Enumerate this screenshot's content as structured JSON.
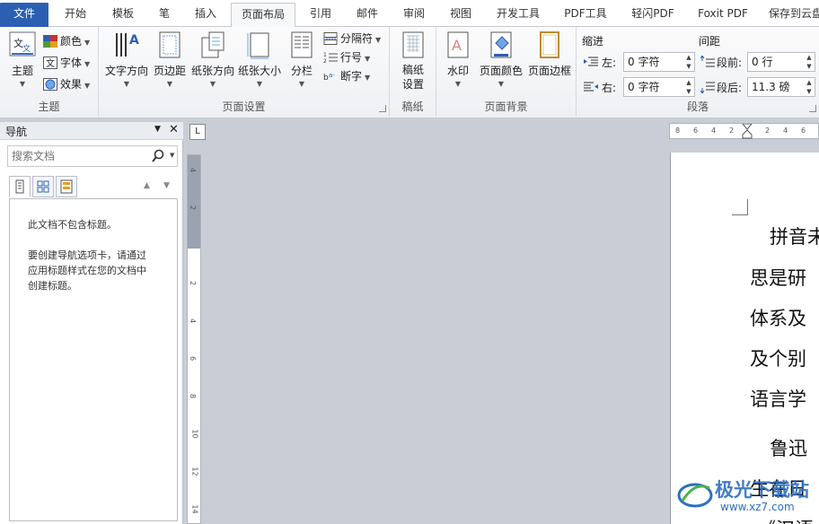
{
  "tabs": [
    {
      "label": "文件",
      "kind": "file"
    },
    {
      "label": "开始"
    },
    {
      "label": "模板"
    },
    {
      "label": "笔"
    },
    {
      "label": "插入"
    },
    {
      "label": "页面布局",
      "kind": "active"
    },
    {
      "label": "引用"
    },
    {
      "label": "邮件"
    },
    {
      "label": "审阅"
    },
    {
      "label": "视图"
    },
    {
      "label": "开发工具"
    },
    {
      "label": "PDF工具"
    },
    {
      "label": "轻闪PDF"
    },
    {
      "label": "Foxit PDF"
    },
    {
      "label": "保存到云盘"
    }
  ],
  "ribbon": {
    "theme": {
      "group_label": "主题",
      "themes_label": "主题",
      "colors_label": "颜色",
      "fonts_label": "字体",
      "effects_label": "效果"
    },
    "page_setup": {
      "group_label": "页面设置",
      "text_direction": "文字方向",
      "margins": "页边距",
      "orientation": "纸张方向",
      "size": "纸张大小",
      "columns": "分栏",
      "breaks": "分隔符",
      "line_numbers": "行号",
      "hyphenation": "断字"
    },
    "paper": {
      "group_label": "稿纸",
      "paper_setup": "稿纸\n设置"
    },
    "page_background": {
      "group_label": "页面背景",
      "watermark": "水印",
      "page_color": "页面颜色",
      "page_borders": "页面边框"
    },
    "paragraph": {
      "group_label": "段落",
      "indent_title": "缩进",
      "spacing_title": "间距",
      "left_label": "左:",
      "left_value": "0 字符",
      "right_label": "右:",
      "right_value": "0 字符",
      "before_label": "段前:",
      "before_value": "0 行",
      "after_label": "段后:",
      "after_value": "11.3 磅"
    }
  },
  "nav": {
    "title": "导航",
    "search_placeholder": "搜索文档",
    "msg1": "此文档不包含标题。",
    "msg2": "要创建导航选项卡，请通过\n应用标题样式在您的文档中\n创建标题。"
  },
  "ruler": {
    "corner": "L",
    "h_labels": [
      "8",
      "6",
      "4",
      "2",
      "",
      "2",
      "4",
      "6"
    ],
    "v_labels": [
      "4",
      "2",
      "",
      "2",
      "4",
      "6",
      "8",
      "10",
      "12",
      "14"
    ]
  },
  "document": {
    "lines": [
      "拼音未",
      "思是研",
      "体系及",
      "及个别",
      "语言学",
      "鲁迅",
      "生在日",
      "《汉语"
    ]
  },
  "watermark": {
    "logo_text": "极光下载站",
    "url": "www.xz7.com"
  },
  "colors": {
    "file_tab": "#2b5fb4",
    "accent": "#c7322b",
    "watermark": "#2d6fc2"
  }
}
